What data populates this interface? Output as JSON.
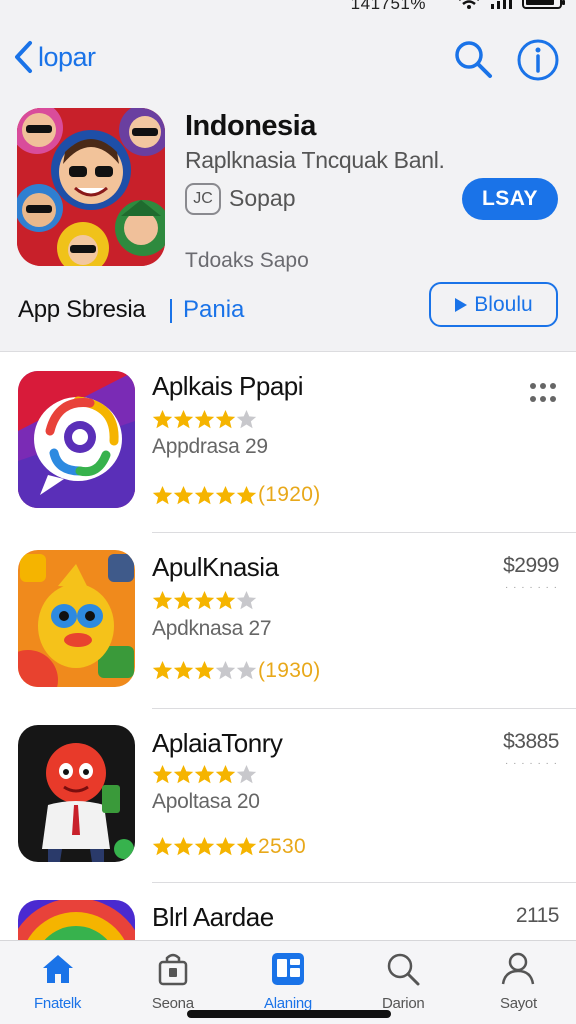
{
  "status_bar": {
    "text": "141751%"
  },
  "header": {
    "back_label": "lopar",
    "title": "Indonesia",
    "subtitle": "Raplknasia Tncquak Banl.",
    "badge": "JC",
    "developer": "Sopap",
    "get_label": "LSAY",
    "caption": "Tdoaks Sapo",
    "category": "App Sbresia",
    "link": "Pania",
    "play_label": "Bloulu"
  },
  "apps": [
    {
      "name": "Aplkais Ppapi",
      "rating": 4,
      "subtitle": "Appdrasa 29",
      "count_rating": 5,
      "count": "(1920)",
      "price": "",
      "has_more": true
    },
    {
      "name": "ApulKnasia",
      "rating": 4,
      "subtitle": "Apdknasa 27",
      "count_rating": 3,
      "count": "(1930)",
      "price": "$2999",
      "has_more": false
    },
    {
      "name": "AplaiaTonry",
      "rating": 4,
      "subtitle": "Apoltasa 20",
      "count_rating": 5,
      "count": "2530",
      "price": "$3885",
      "has_more": false
    },
    {
      "name": "Blrl Aardae",
      "rating": 0,
      "subtitle": "",
      "count_rating": 0,
      "count": "",
      "price": "2115",
      "has_more": false
    }
  ],
  "tabs": [
    {
      "label": "Fnatelk",
      "icon": "home-icon",
      "active": true
    },
    {
      "label": "Seona",
      "icon": "bag-icon",
      "active": false
    },
    {
      "label": "Alaning",
      "icon": "grid-icon",
      "active": true
    },
    {
      "label": "Darion",
      "icon": "search-icon",
      "active": false
    },
    {
      "label": "Sayot",
      "icon": "person-icon",
      "active": false
    }
  ],
  "colors": {
    "accent": "#1a73e8",
    "star": "#f5b400",
    "count": "#e8a81a"
  }
}
